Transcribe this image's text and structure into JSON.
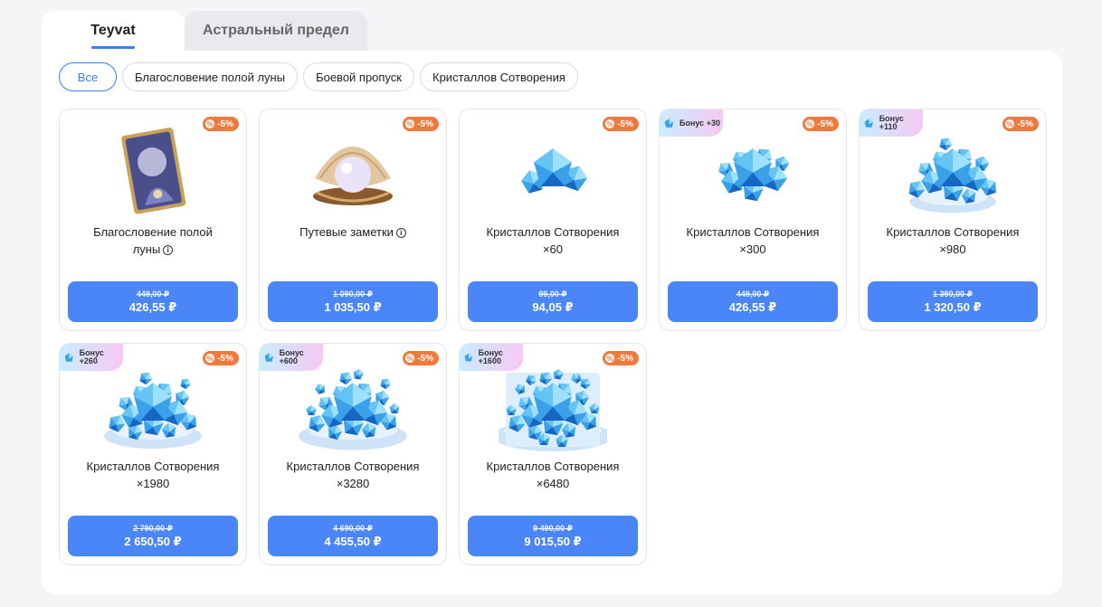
{
  "tabs": [
    {
      "label": "Teyvat",
      "active": true
    },
    {
      "label": "Астральный предел",
      "active": false
    }
  ],
  "filters": [
    {
      "label": "Все",
      "active": true
    },
    {
      "label": "Благословение полой луны",
      "active": false
    },
    {
      "label": "Боевой пропуск",
      "active": false
    },
    {
      "label": "Кристаллов Сотворения",
      "active": false
    }
  ],
  "colors": {
    "accent": "#4a86f7",
    "discount": "#f07a3c"
  },
  "products": [
    {
      "name": "Благословение полой луны",
      "qty": "",
      "info": true,
      "art": "card",
      "discount": "-5%",
      "bonus": null,
      "old_price": "449,00 ₽",
      "new_price": "426,55 ₽"
    },
    {
      "name": "Путевые заметки",
      "qty": "",
      "info": true,
      "art": "pearl",
      "discount": "-5%",
      "bonus": null,
      "old_price": "1 090,00 ₽",
      "new_price": "1 035,50 ₽"
    },
    {
      "name": "Кристаллов Сотворения",
      "qty": "×60",
      "info": false,
      "art": "crystal-1",
      "discount": "-5%",
      "bonus": null,
      "old_price": "99,00 ₽",
      "new_price": "94,05 ₽"
    },
    {
      "name": "Кристаллов Сотворения",
      "qty": "×300",
      "info": false,
      "art": "crystal-2",
      "discount": "-5%",
      "bonus": "Бонус +30",
      "old_price": "449,00 ₽",
      "new_price": "426,55 ₽"
    },
    {
      "name": "Кристаллов Сотворения",
      "qty": "×980",
      "info": false,
      "art": "crystal-3",
      "discount": "-5%",
      "bonus": "Бонус +110",
      "old_price": "1 390,00 ₽",
      "new_price": "1 320,50 ₽"
    },
    {
      "name": "Кристаллов Сотворения",
      "qty": "×1980",
      "info": false,
      "art": "crystal-4",
      "discount": "-5%",
      "bonus": "Бонус +260",
      "old_price": "2 790,00 ₽",
      "new_price": "2 650,50 ₽"
    },
    {
      "name": "Кристаллов Сотворения",
      "qty": "×3280",
      "info": false,
      "art": "crystal-5",
      "discount": "-5%",
      "bonus": "Бонус +600",
      "old_price": "4 690,00 ₽",
      "new_price": "4 455,50 ₽"
    },
    {
      "name": "Кристаллов Сотворения",
      "qty": "×6480",
      "info": false,
      "art": "crystal-6",
      "discount": "-5%",
      "bonus": "Бонус +1600",
      "old_price": "9 490,00 ₽",
      "new_price": "9 015,50 ₽"
    }
  ]
}
